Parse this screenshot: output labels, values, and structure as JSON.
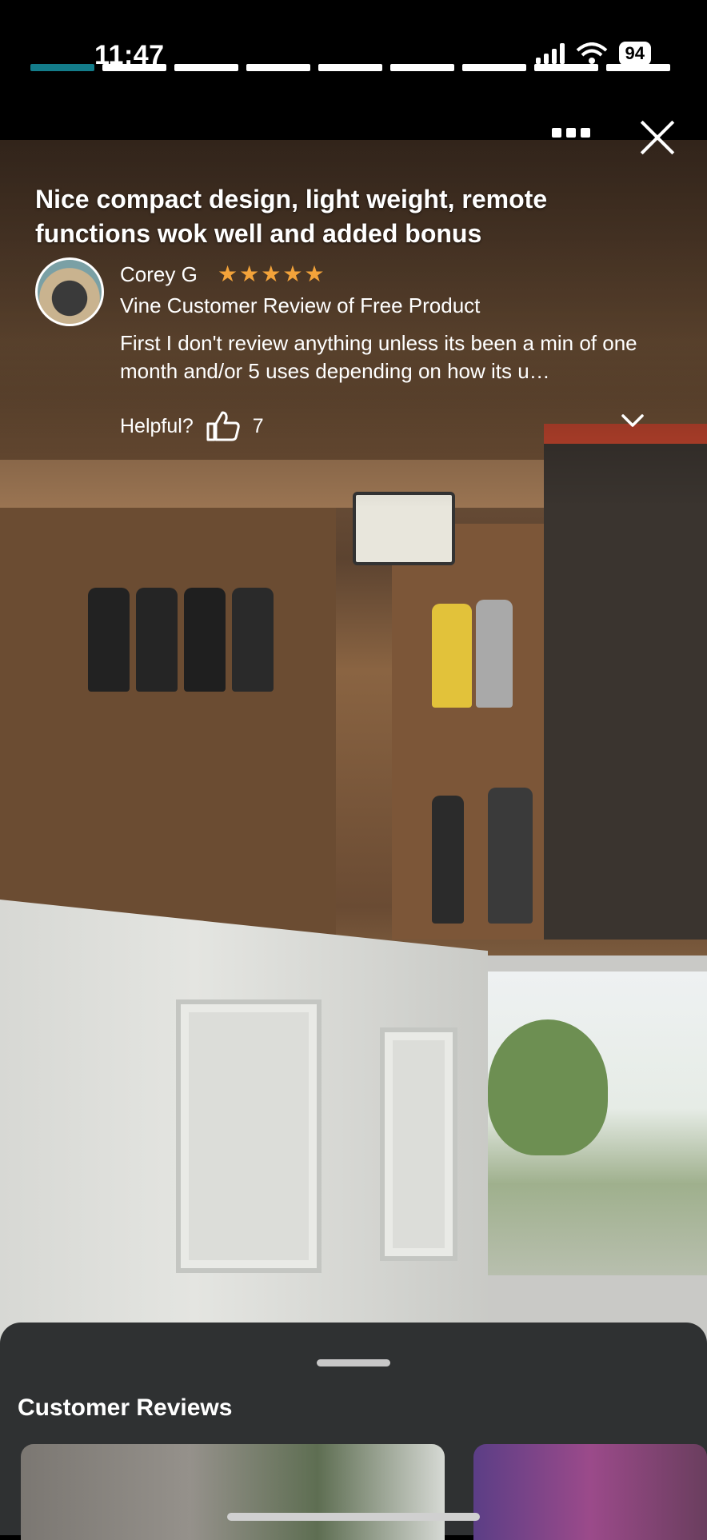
{
  "status_bar": {
    "time": "11:47",
    "battery": "94"
  },
  "story": {
    "segments_total": 9,
    "active_segment": 1
  },
  "review": {
    "title": "Nice compact design, light weight, remote functions wok well and added bonus",
    "author": "Corey G",
    "rating": 5,
    "badge": "Vine Customer Review of Free Product",
    "text": "First I don't review anything unless its been a min of one month and/or 5 uses depending on how its u…",
    "helpful_label": "Helpful?",
    "helpful_count": "7"
  },
  "icons": [
    "more-icon",
    "close-icon",
    "thumbs-up-icon",
    "chevron-down-icon",
    "wifi-icon",
    "signal-icon",
    "battery-icon"
  ],
  "sheet": {
    "title": "Customer Reviews"
  },
  "colors": {
    "progress_active": "#137c8a",
    "star": "#f3a33a",
    "sheet_bg": "#2f3132"
  }
}
